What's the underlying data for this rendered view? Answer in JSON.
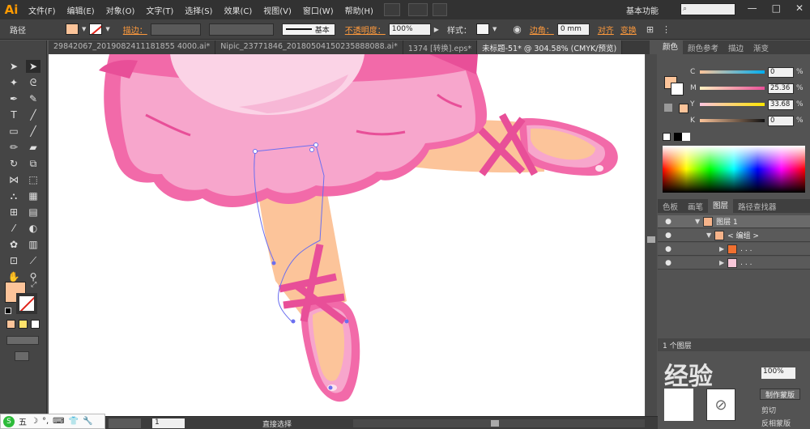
{
  "app": {
    "logo": "Ai"
  },
  "menu": [
    "文件(F)",
    "编辑(E)",
    "对象(O)",
    "文字(T)",
    "选择(S)",
    "效果(C)",
    "视图(V)",
    "窗口(W)",
    "帮助(H)"
  ],
  "workspace": "基本功能",
  "window_buttons": [
    "—",
    "□",
    "✕"
  ],
  "control": {
    "selection_label": "路径",
    "stroke_label": "描边：",
    "stroke_profile": "基本",
    "opacity_label": "不透明度：",
    "opacity_value": "100%",
    "style_label": "样式：",
    "corner_label": "边角：",
    "corner_value": "0 mm",
    "align_label": "对齐",
    "transform_label": "变换",
    "fill_color": "#fcc49a"
  },
  "tabs": [
    {
      "label": "29842067_2019082411181855 4000.ai*",
      "active": false
    },
    {
      "label": "Nipic_23771846_20180504150235888088.ai*",
      "active": false
    },
    {
      "label": "1374 [转换].eps*",
      "active": false
    },
    {
      "label": "未标题-51* @ 304.58% (CMYK/预览)",
      "active": true
    }
  ],
  "color_panel": {
    "tabs": [
      "颜色",
      "颜色参考",
      "描边",
      "渐变"
    ],
    "channels": [
      {
        "name": "C",
        "value": "0"
      },
      {
        "name": "M",
        "value": "25.36"
      },
      {
        "name": "Y",
        "value": "33.68"
      },
      {
        "name": "K",
        "value": "0"
      }
    ],
    "percent": "%"
  },
  "layers_panel": {
    "tabs": [
      "色板",
      "画笔",
      "图层",
      "路径查找器"
    ],
    "rows": [
      {
        "name": "图层 1",
        "indent": 0
      },
      {
        "name": "< 编组 >",
        "indent": 1
      },
      {
        "name": ". . .",
        "indent": 2
      },
      {
        "name": ". . .",
        "indent": 2
      }
    ],
    "count": "1 个图层"
  },
  "transparency_panel": {
    "opacity_value": "100%",
    "make_mask": "制作蒙版",
    "clip": "剪切",
    "invert": "反相蒙版"
  },
  "status": {
    "zoom": "304.58%",
    "page": "1",
    "tool": "直接选择"
  },
  "watermark": "经验",
  "ime": [
    "五",
    "☽",
    "°,",
    "⌨",
    "👕",
    "🔧"
  ],
  "colors": {
    "pink": "#f26aa9",
    "skin": "#fcc49a",
    "light_pink": "#f7a6cc"
  }
}
